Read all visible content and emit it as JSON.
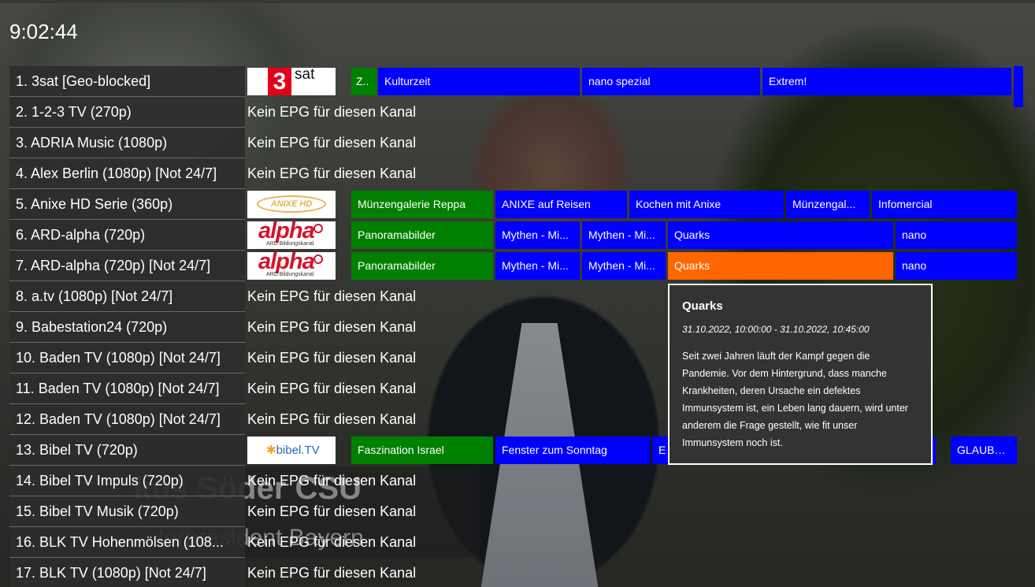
{
  "clock": "9:02:44",
  "background_caption": {
    "name": "kus Söder  CSU",
    "role": "terpräsident Bayern"
  },
  "no_epg_text": "Kein EPG für diesen Kanal",
  "colors": {
    "current_program": "#008000",
    "upcoming_program": "#0000ff",
    "selected_program": "#ff6600",
    "channel_bg": "#2d2d2d"
  },
  "logos": {
    "3sat": {
      "icon": "3sat-logo",
      "text_3": "3",
      "text_sat": "sat"
    },
    "anixe": {
      "icon": "anixe-hd-logo",
      "text": "ANIXE HD"
    },
    "alpha": {
      "icon": "ard-alpha-logo",
      "text": "alpha",
      "sub": "ARD Bildungskanal"
    },
    "bibel": {
      "icon": "bibel-tv-logo",
      "star": "✱",
      "text": "bibel.TV"
    }
  },
  "channels": [
    {
      "label": "1. 3sat [Geo-blocked]",
      "programs": [
        "Z..",
        "Kulturzeit",
        "nano spezial",
        "Extrem!"
      ]
    },
    {
      "label": "2. 1-2-3 TV (270p)"
    },
    {
      "label": "3. ADRIA Music (1080p)"
    },
    {
      "label": "4. Alex Berlin (1080p) [Not 24/7]"
    },
    {
      "label": "5. Anixe HD Serie (360p)",
      "programs": [
        "Münzengalerie Reppa",
        "ANIXE auf Reisen",
        "Kochen mit Anixe",
        "Münzengal...",
        "Infomercial"
      ]
    },
    {
      "label": "6. ARD-alpha (720p)",
      "programs": [
        "Panoramabilder",
        "Mythen - Mi...",
        "Mythen - Mi...",
        "Quarks",
        "nano"
      ]
    },
    {
      "label": "7. ARD-alpha (720p) [Not 24/7]",
      "programs": [
        "Panoramabilder",
        "Mythen - Mi...",
        "Mythen - Mi...",
        "Quarks",
        "nano"
      ]
    },
    {
      "label": "8. a.tv (1080p) [Not 24/7]"
    },
    {
      "label": "9. Babestation24 (720p)"
    },
    {
      "label": "10. Baden TV (1080p) [Not 24/7]"
    },
    {
      "label": "11. Baden TV (1080p) [Not 24/7]"
    },
    {
      "label": "12. Baden TV (1080p) [Not 24/7]"
    },
    {
      "label": "13. Bibel TV (720p)",
      "programs": [
        "Faszination Israel",
        "Fenster zum Sonntag",
        "E",
        "GLAUBEN..."
      ]
    },
    {
      "label": "14. Bibel TV Impuls (720p)"
    },
    {
      "label": "15. Bibel TV Musik (720p)"
    },
    {
      "label": "16. BLK TV Hohenmölsen (108..."
    },
    {
      "label": "17. BLK TV (1080p) [Not 24/7]"
    }
  ],
  "tooltip": {
    "title": "Quarks",
    "time": "31.10.2022, 10:00:00 - 31.10.2022, 10:45:00",
    "description": "Seit zwei Jahren läuft der Kampf gegen die Pandemie. Vor dem Hintergrund, dass manche Krankheiten, deren Ursache ein defektes Immunsystem ist, ein Leben lang dauern, wird unter anderem die Frage gestellt, wie fit unser Immunsystem noch ist."
  }
}
